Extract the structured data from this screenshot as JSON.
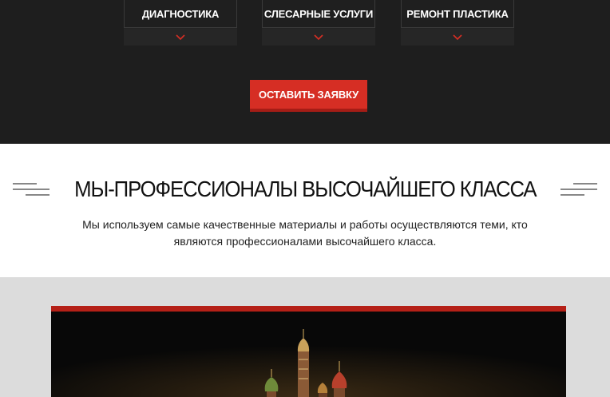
{
  "services": [
    {
      "label": "ДИАГНОСТИКА"
    },
    {
      "label": "СЛЕСАРНЫЕ УСЛУГИ"
    },
    {
      "label": "РЕМОНТ ПЛАСТИКА"
    }
  ],
  "cta": {
    "label": "ОСТАВИТЬ ЗАЯВКУ"
  },
  "pro": {
    "title": "МЫ-ПРОФЕССИОНАЛЫ ВЫСОЧАЙШЕГО КЛАССА",
    "description_line1": "Мы используем самые качественные материалы и работы осуществляются теми, кто",
    "description_line2": "являются профессионалами высочайшего класса."
  },
  "colors": {
    "accent": "#d62e24",
    "dark_bg": "#1e1e1e",
    "gallery_bg": "#dcdcdc"
  },
  "icons": {
    "chevron": "chevron-down-icon",
    "heading_decoration": "triple-line-decoration"
  }
}
